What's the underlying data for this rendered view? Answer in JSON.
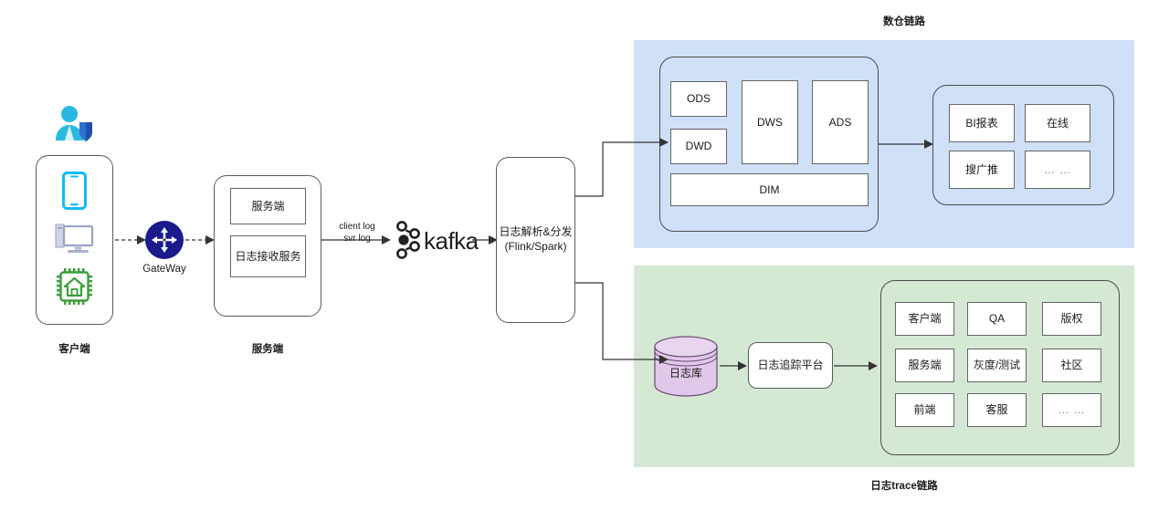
{
  "diagram": {
    "title_dw": "数仓链路",
    "title_trace": "日志trace链路"
  },
  "client": {
    "caption": "客户端",
    "icons": [
      {
        "name": "mobile-phone-icon",
        "label": "mobile"
      },
      {
        "name": "desktop-computer-icon",
        "label": "desktop"
      },
      {
        "name": "iot-chip-icon",
        "label": "iot"
      }
    ],
    "user_icon": "user-shield-icon"
  },
  "gateway": {
    "label": "GateWay",
    "icon": "gateway-router-icon",
    "color": "#1a1a8c"
  },
  "server": {
    "caption": "服务端",
    "boxes": [
      {
        "label": "服务端"
      },
      {
        "label": "日志接收服务"
      }
    ]
  },
  "kafka": {
    "wordmark": "kafka",
    "icon": "kafka-logo-icon",
    "edge_label_line1": "client log",
    "edge_label_line2": "svr log"
  },
  "processor": {
    "line1": "日志解析&分发",
    "line2": "(Flink/Spark)"
  },
  "dw": {
    "layers": [
      {
        "label": "ODS"
      },
      {
        "label": "DWD"
      },
      {
        "label": "DWS"
      },
      {
        "label": "ADS"
      },
      {
        "label": "DIM"
      }
    ],
    "consumers": [
      {
        "label": "BI报表"
      },
      {
        "label": "在线"
      },
      {
        "label": "搜广推"
      },
      {
        "label": "… …"
      }
    ],
    "bg_color": "#cfe0f7"
  },
  "trace": {
    "db_label": "日志库",
    "db_color": "#e1c8ea",
    "platform_label": "日志追踪平台",
    "consumers": [
      {
        "label": "客户端"
      },
      {
        "label": "QA"
      },
      {
        "label": "版权"
      },
      {
        "label": "服务端"
      },
      {
        "label": "灰度/测试"
      },
      {
        "label": "社区"
      },
      {
        "label": "前端"
      },
      {
        "label": "客服"
      },
      {
        "label": "… …"
      }
    ],
    "bg_color": "#d5e8d4"
  }
}
